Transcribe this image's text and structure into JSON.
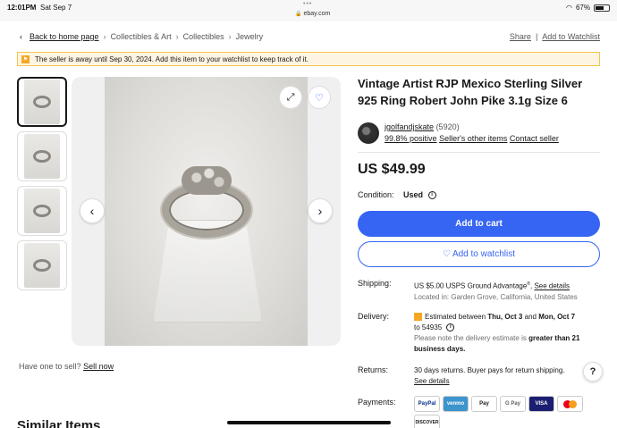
{
  "status_bar": {
    "time": "12:01PM",
    "date": "Sat Sep 7",
    "url": "ebay.com",
    "battery": "67%",
    "battery_level": 0.67
  },
  "breadcrumb": {
    "back": "Back to home page",
    "items": [
      "Collectibles & Art",
      "Collectibles",
      "Jewelry"
    ]
  },
  "top_links": {
    "share": "Share",
    "sep": "|",
    "watchlist": "Add to Watchlist"
  },
  "alert": {
    "text": "The seller is away until Sep 30, 2024. Add this item to your watchlist to keep track of it."
  },
  "listing": {
    "title": "Vintage Artist RJP Mexico Sterling Silver 925 Ring Robert John Pike 3.1g Size 6",
    "seller": {
      "name": "jgolfandjskate",
      "feedback_count": "(5920)",
      "positive": "99.8% positive",
      "other_items": "Seller's other items",
      "contact": "Contact seller"
    },
    "price": "US $49.99",
    "condition_label": "Condition:",
    "condition_value": "Used",
    "add_to_cart": "Add to cart",
    "add_to_watchlist": "Add to watchlist",
    "shipping_label": "Shipping:",
    "shipping_value": "US $5.00 USPS Ground Advantage",
    "shipping_reg": "®",
    "shipping_link": "See details",
    "location": "Located in: Garden Grove, California, United States",
    "delivery_label": "Delivery:",
    "delivery_text_a": "Estimated between ",
    "delivery_date_a": "Thu, Oct 3",
    "delivery_text_b": " and ",
    "delivery_date_b": "Mon, Oct 7",
    "delivery_text_c": "to 54935",
    "delivery_note_a": "Please note the delivery estimate is ",
    "delivery_note_b": "greater than 21 business days.",
    "returns_label": "Returns:",
    "returns_value": "30 days returns. Buyer pays for return shipping.",
    "returns_link": "See details",
    "payments_label": "Payments:",
    "payment_methods": [
      "PayPal",
      "venmo",
      "Pay",
      "G Pay",
      "VISA",
      "",
      "DISCOVER"
    ]
  },
  "sell": {
    "prompt": "Have one to sell?",
    "link": "Sell now"
  },
  "similar": {
    "heading": "Similar Items"
  },
  "help": "?"
}
